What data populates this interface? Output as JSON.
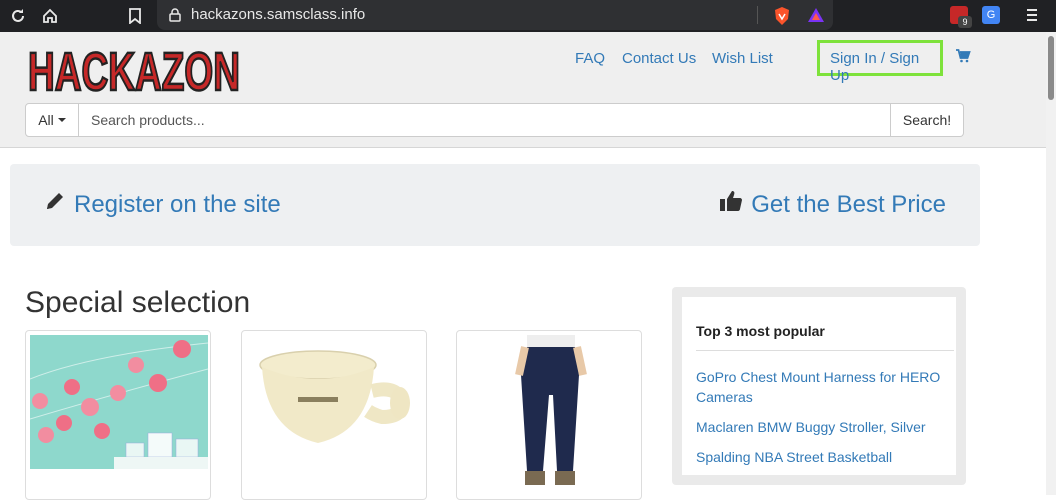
{
  "browser": {
    "url": "hackazons.samsclass.info",
    "extension_badge": "9",
    "extension_translate": "G"
  },
  "header": {
    "logo_text": "HACKAZON",
    "nav": {
      "faq": "FAQ",
      "contact": "Contact Us",
      "wishlist": "Wish List",
      "signin": "Sign In / Sign Up"
    },
    "search": {
      "category": "All",
      "placeholder": "Search products...",
      "button": "Search!"
    }
  },
  "banner": {
    "register": "Register on the site",
    "best_price": "Get the Best Price"
  },
  "main": {
    "section_title": "Special selection",
    "products": [
      {
        "image": "pink-pompom-garland-with-gifts"
      },
      {
        "image": "cream-shaving-mug"
      },
      {
        "image": "man-in-dark-jeans"
      }
    ]
  },
  "popular": {
    "title": "Top 3 most popular",
    "items": [
      "GoPro Chest Mount Harness for HERO Cameras",
      "Maclaren BMW Buggy Stroller, Silver",
      "Spalding NBA Street Basketball"
    ]
  },
  "colors": {
    "link": "#337ab7",
    "highlight": "#7ee23b",
    "logo_red": "#c62828",
    "chrome_bg": "#202124"
  }
}
